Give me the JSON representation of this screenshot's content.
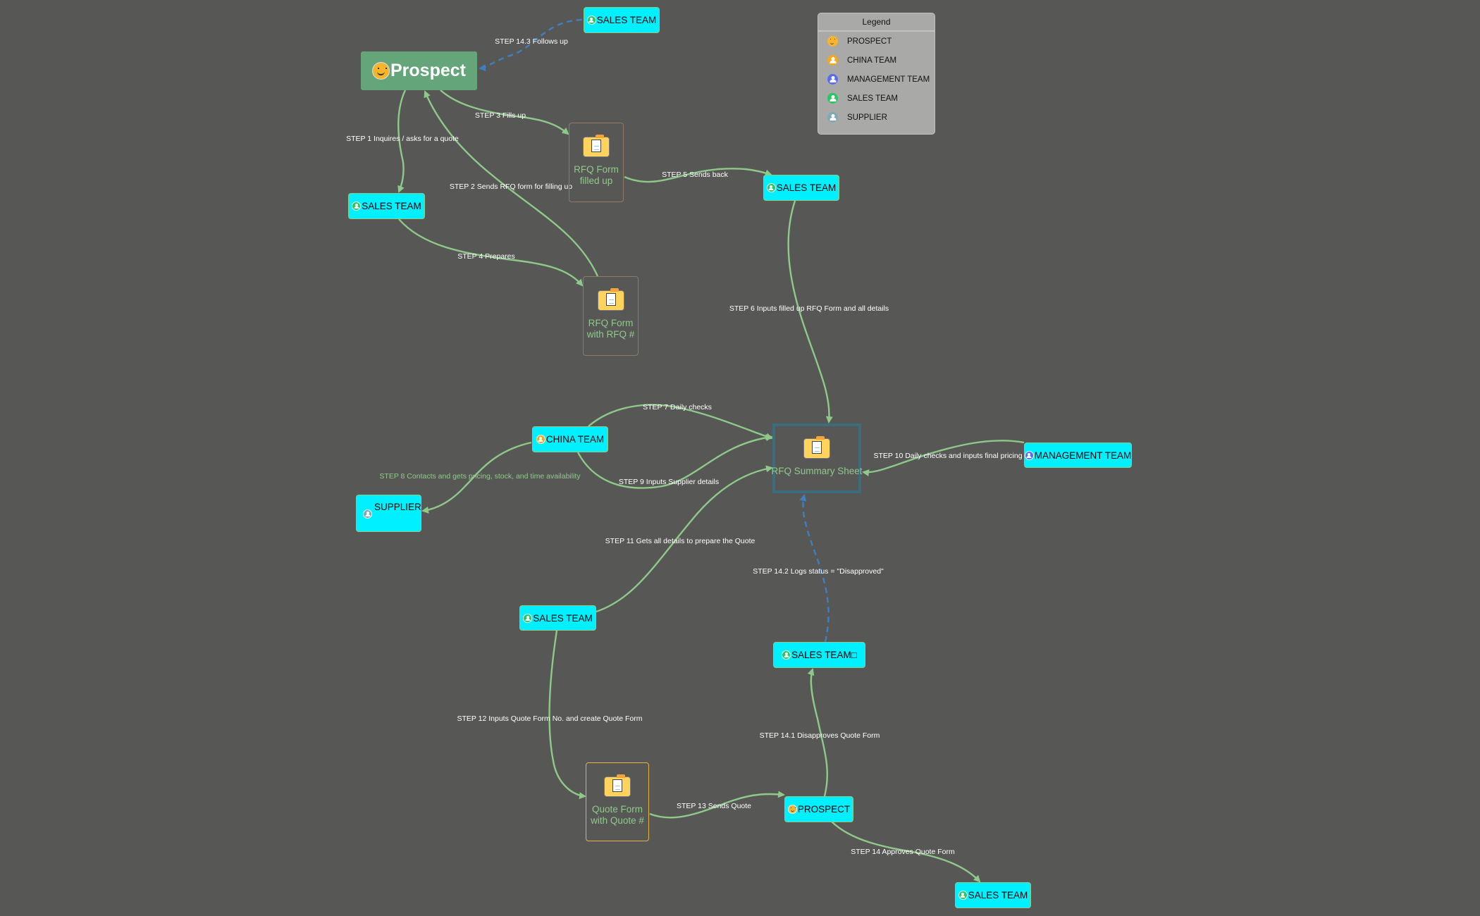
{
  "legend": {
    "title": "Legend",
    "items": [
      {
        "label": "PROSPECT",
        "icon": "smiley-icon",
        "color": "#f8b52c"
      },
      {
        "label": "CHINA TEAM",
        "icon": "person-icon",
        "color": "#f5a81c"
      },
      {
        "label": "MANAGEMENT TEAM",
        "icon": "person-icon",
        "color": "#5b6cf0"
      },
      {
        "label": "SALES TEAM",
        "icon": "person-icon",
        "color": "#29c763"
      },
      {
        "label": "SUPPLIER",
        "icon": "person-icon",
        "color": "#7fa9b3"
      }
    ]
  },
  "nodes": {
    "prospect_main": {
      "label": "Prospect"
    },
    "sales_top": {
      "label": "SALES TEAM"
    },
    "sales_step1": {
      "label": "SALES TEAM"
    },
    "rfq_filled": {
      "label": "RFQ  Form filled up"
    },
    "sales_step5": {
      "label": "SALES TEAM"
    },
    "rfq_number": {
      "label": "RFQ Form with RFQ #"
    },
    "china_team": {
      "label": "CHINA TEAM"
    },
    "supplier": {
      "label": "SUPPLIER"
    },
    "rfq_summary": {
      "label": "RFQ Summary Sheet"
    },
    "management": {
      "label": "MANAGEMENT TEAM"
    },
    "sales_step11": {
      "label": "SALES TEAM"
    },
    "sales_step141": {
      "label": "SALES TEAM□"
    },
    "quote_form": {
      "label": "Quote Form with Quote #"
    },
    "prospect_bottom": {
      "label": "PROSPECT"
    },
    "sales_bottom": {
      "label": "SALES TEAM"
    }
  },
  "edges": [
    {
      "id": "step1",
      "label": "STEP 1 Inquires / asks for a quote",
      "from": "prospect_main",
      "to": "sales_step1"
    },
    {
      "id": "step2",
      "label": "STEP 2  Sends RFQ form for filling up",
      "from": "rfq_number",
      "to": "prospect_main"
    },
    {
      "id": "step3",
      "label": "STEP 3 Fills up",
      "from": "prospect_main",
      "to": "rfq_filled"
    },
    {
      "id": "step4",
      "label": "STEP 4 Prepares",
      "from": "sales_step1",
      "to": "rfq_number"
    },
    {
      "id": "step5",
      "label": "STEP 5 Sends back",
      "from": "rfq_filled",
      "to": "sales_step5"
    },
    {
      "id": "step6",
      "label": "STEP 6 Inputs filled up RFQ Form  and all details",
      "from": "sales_step5",
      "to": "rfq_summary"
    },
    {
      "id": "step7",
      "label": "STEP 7 Daily checks",
      "from": "china_team",
      "to": "rfq_summary"
    },
    {
      "id": "step8",
      "label": "STEP 8 Contacts and gets pricing, stock, and time availability",
      "from": "china_team",
      "to": "supplier"
    },
    {
      "id": "step9",
      "label": "STEP 9 Inputs Supplier details",
      "from": "china_team",
      "to": "rfq_summary"
    },
    {
      "id": "step10",
      "label": "STEP 10 Daily checks and inputs final pricing",
      "from": "management",
      "to": "rfq_summary"
    },
    {
      "id": "step11",
      "label": "STEP 11 Gets all details to prepare the Quote",
      "from": "sales_step11",
      "to": "rfq_summary"
    },
    {
      "id": "step12",
      "label": "STEP 12 Inputs Quote Form No. and create Quote Form",
      "from": "sales_step11",
      "to": "quote_form"
    },
    {
      "id": "step13",
      "label": "STEP 13 Sends Quote",
      "from": "quote_form",
      "to": "prospect_bottom"
    },
    {
      "id": "step14",
      "label": "STEP 14  Approves Quote Form",
      "from": "prospect_bottom",
      "to": "sales_bottom"
    },
    {
      "id": "step141",
      "label": "STEP 14.1 Disapproves Quote Form",
      "from": "prospect_bottom",
      "to": "sales_step141"
    },
    {
      "id": "step142",
      "label": "STEP 14.2 Logs status = \"Disapproved\"",
      "from": "sales_step141",
      "to": "rfq_summary"
    },
    {
      "id": "step143",
      "label": "STEP 14.3 Follows up",
      "from": "sales_top",
      "to": "prospect_main"
    }
  ],
  "colors": {
    "background": "#575856",
    "edge": "#8fc98a",
    "dashed_edge": "#3f7fbf",
    "person_node": "#00f0ff",
    "prospect_node": "#65a57a"
  }
}
